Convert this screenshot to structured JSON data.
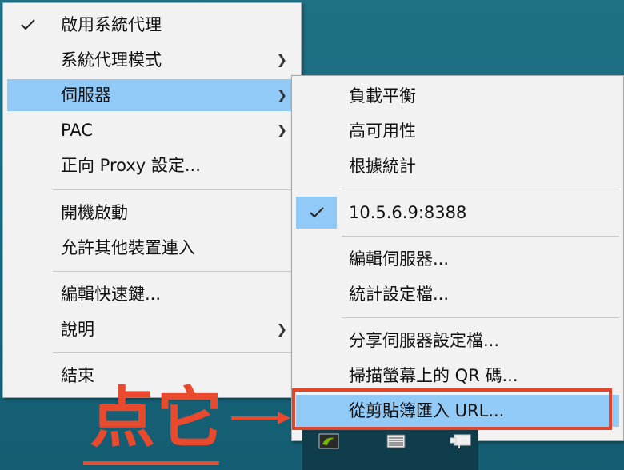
{
  "main_menu": {
    "items": [
      {
        "label": "啟用系統代理",
        "checked": true
      },
      {
        "label": "系統代理模式",
        "submenu": true
      },
      {
        "label": "伺服器",
        "submenu": true,
        "highlighted": true
      },
      {
        "label": "PAC",
        "submenu": true
      },
      {
        "label": "正向 Proxy 設定..."
      },
      {
        "label": "開機啟動"
      },
      {
        "label": "允許其他裝置連入"
      },
      {
        "label": "編輯快速鍵..."
      },
      {
        "label": "說明",
        "submenu": true
      },
      {
        "label": "結束"
      }
    ]
  },
  "server_submenu": {
    "items": [
      {
        "label": "負載平衡"
      },
      {
        "label": "高可用性"
      },
      {
        "label": "根據統計"
      },
      {
        "label": "10.5.6.9:8388",
        "checked": true
      },
      {
        "label": "編輯伺服器..."
      },
      {
        "label": "統計設定檔..."
      },
      {
        "label": "分享伺服器設定檔..."
      },
      {
        "label": "掃描螢幕上的 QR 碼..."
      },
      {
        "label": "從剪貼簿匯入 URL...",
        "highlighted": true
      }
    ]
  },
  "annotation": {
    "text": "点它",
    "color": "#e94a2d"
  },
  "colors": {
    "highlight": "#91c9f7",
    "menu_bg": "#f2f2f2",
    "desktop": "#1a6a80"
  },
  "tray_icons": [
    "nvidia-icon",
    "keyboard-icon",
    "network-icon"
  ]
}
